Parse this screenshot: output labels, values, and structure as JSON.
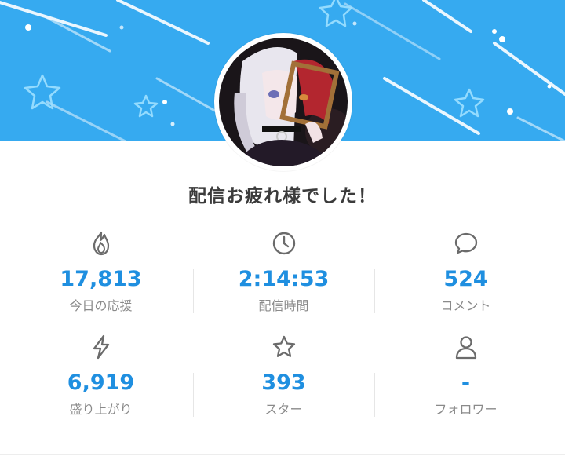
{
  "banner": {
    "color": "#36aaf0"
  },
  "avatar": {
    "icon": "streamer-avatar"
  },
  "title": "配信お疲れ様でした！",
  "stats": [
    {
      "icon": "flame-icon",
      "value": "17,813",
      "label": "今日の応援"
    },
    {
      "icon": "clock-icon",
      "value": "2:14:53",
      "label": "配信時間"
    },
    {
      "icon": "comment-icon",
      "value": "524",
      "label": "コメント"
    },
    {
      "icon": "bolt-icon",
      "value": "6,919",
      "label": "盛り上がり"
    },
    {
      "icon": "star-icon",
      "value": "393",
      "label": "スター"
    },
    {
      "icon": "person-icon",
      "value": "-",
      "label": "フォロワー"
    }
  ],
  "colors": {
    "accent": "#1f8fe0",
    "label": "#8a8a8a",
    "icon": "#6b6b6b"
  }
}
